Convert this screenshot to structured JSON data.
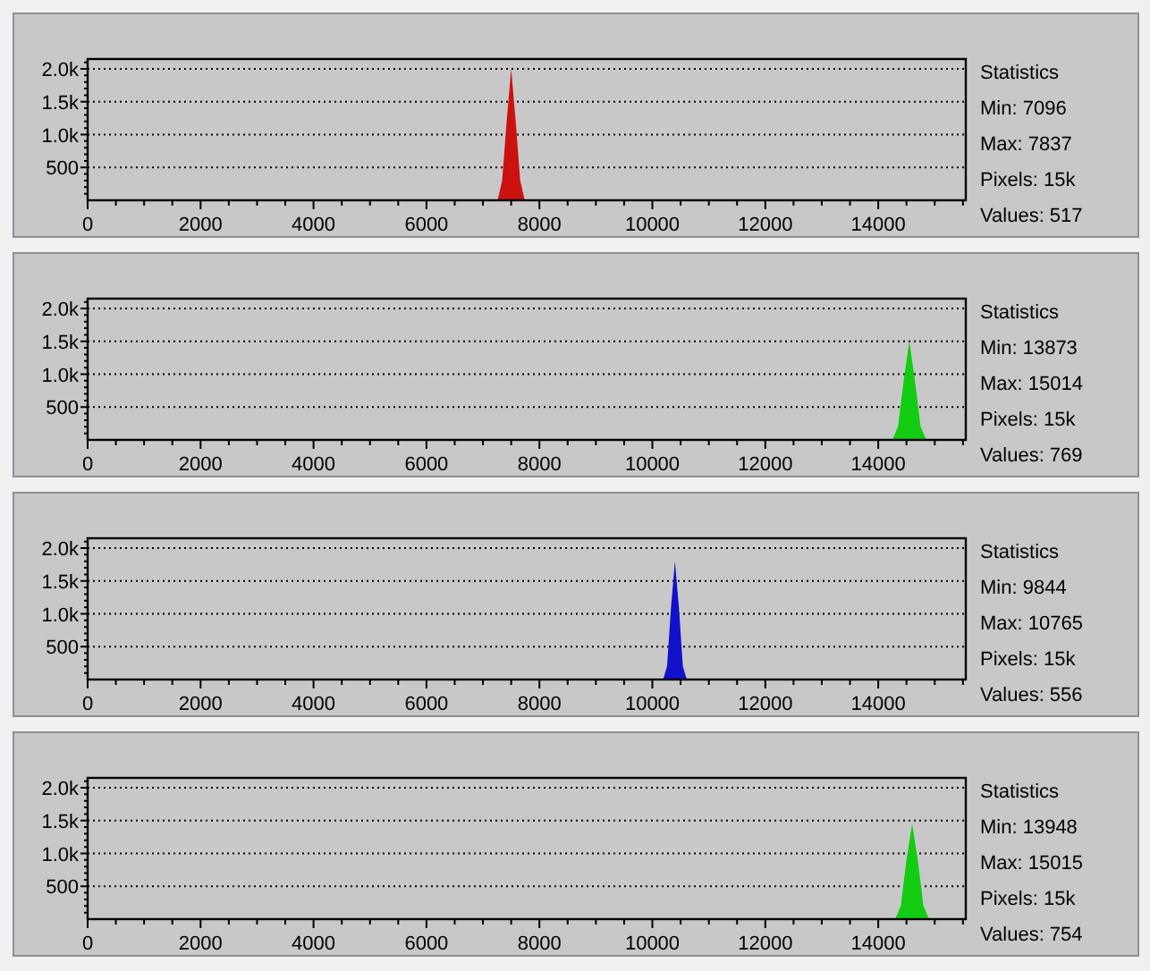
{
  "panels": [
    {
      "chart_data": {
        "type": "area",
        "x": [
          7260,
          7340,
          7420,
          7500,
          7580,
          7660,
          7740
        ],
        "grid": true,
        "series": [
          {
            "color": "#cc1111",
            "values": [
              0,
              300,
              1200,
              2000,
              1200,
              300,
              0
            ]
          }
        ],
        "xlim": [
          0,
          15550
        ],
        "ylim": [
          0,
          2150
        ],
        "xticks": [
          0,
          2000,
          4000,
          6000,
          8000,
          10000,
          12000,
          14000
        ],
        "yticks": [
          {
            "value": 500,
            "label": "500"
          },
          {
            "value": 1000,
            "label": "1.0k"
          },
          {
            "value": 1500,
            "label": "1.5k"
          },
          {
            "value": 2000,
            "label": "2.0k"
          }
        ]
      },
      "stats": {
        "heading": "Statistics",
        "lines": [
          "Min: 7096",
          "Max: 7837",
          "Pixels: 15k",
          "Values: 517"
        ]
      }
    },
    {
      "chart_data": {
        "type": "area",
        "x": [
          14250,
          14350,
          14450,
          14550,
          14650,
          14750,
          14850
        ],
        "grid": true,
        "series": [
          {
            "color": "#11cc11",
            "values": [
              0,
              200,
              900,
              1500,
              900,
              200,
              0
            ]
          }
        ],
        "xlim": [
          0,
          15550
        ],
        "ylim": [
          0,
          2150
        ],
        "xticks": [
          0,
          2000,
          4000,
          6000,
          8000,
          10000,
          12000,
          14000
        ],
        "yticks": [
          {
            "value": 500,
            "label": "500"
          },
          {
            "value": 1000,
            "label": "1.0k"
          },
          {
            "value": 1500,
            "label": "1.5k"
          },
          {
            "value": 2000,
            "label": "2.0k"
          }
        ]
      },
      "stats": {
        "heading": "Statistics",
        "lines": [
          "Min: 13873",
          "Max: 15014",
          "Pixels: 15k",
          "Values: 769"
        ]
      }
    },
    {
      "chart_data": {
        "type": "area",
        "x": [
          10190,
          10260,
          10330,
          10400,
          10470,
          10540,
          10610
        ],
        "grid": true,
        "series": [
          {
            "color": "#1111cc",
            "values": [
              0,
              200,
              1100,
              1800,
              1100,
              200,
              0
            ]
          }
        ],
        "xlim": [
          0,
          15550
        ],
        "ylim": [
          0,
          2150
        ],
        "xticks": [
          0,
          2000,
          4000,
          6000,
          8000,
          10000,
          12000,
          14000
        ],
        "yticks": [
          {
            "value": 500,
            "label": "500"
          },
          {
            "value": 1000,
            "label": "1.0k"
          },
          {
            "value": 1500,
            "label": "1.5k"
          },
          {
            "value": 2000,
            "label": "2.0k"
          }
        ]
      },
      "stats": {
        "heading": "Statistics",
        "lines": [
          "Min: 9844",
          "Max: 10765",
          "Pixels: 15k",
          "Values: 556"
        ]
      }
    },
    {
      "chart_data": {
        "type": "area",
        "x": [
          14300,
          14400,
          14500,
          14600,
          14700,
          14800,
          14900
        ],
        "grid": true,
        "series": [
          {
            "color": "#11cc11",
            "values": [
              0,
              200,
              900,
              1450,
              900,
              200,
              0
            ]
          }
        ],
        "xlim": [
          0,
          15550
        ],
        "ylim": [
          0,
          2150
        ],
        "xticks": [
          0,
          2000,
          4000,
          6000,
          8000,
          10000,
          12000,
          14000
        ],
        "yticks": [
          {
            "value": 500,
            "label": "500"
          },
          {
            "value": 1000,
            "label": "1.0k"
          },
          {
            "value": 1500,
            "label": "1.5k"
          },
          {
            "value": 2000,
            "label": "2.0k"
          }
        ]
      },
      "stats": {
        "heading": "Statistics",
        "lines": [
          "Min: 13948",
          "Max: 15015",
          "Pixels: 15k",
          "Values: 754"
        ]
      }
    }
  ]
}
